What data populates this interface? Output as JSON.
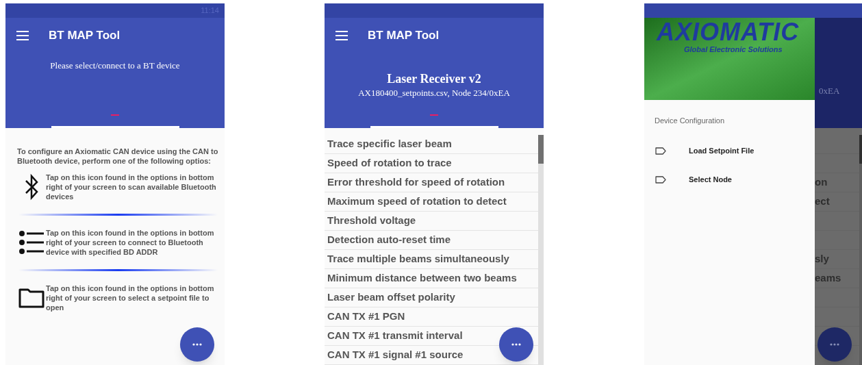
{
  "screens": [
    {
      "kind": "welcome",
      "status_bar": {
        "time": "11:14"
      },
      "app_bar": {
        "title": "BT MAP Tool",
        "message": "Please select/connect to a BT device"
      },
      "intro": "To configure an Axiomatic CAN device using the CAN to Bluetooth device, perform one of the following optios:",
      "options": [
        {
          "kind": "bluetooth",
          "text": "Tap on this icon found in the options in bottom right of your screen to scan available Bluetooth devices"
        },
        {
          "kind": "list",
          "text": "Tap on this icon found in the options in bottom right of your screen to connect to Bluetooth device with specified BD ADDR"
        },
        {
          "kind": "folder",
          "text": "Tap on this icon found in the options in bottom right of your screen to select a setpoint file to open"
        }
      ]
    },
    {
      "kind": "settings_list",
      "app_bar": {
        "title": "BT MAP Tool",
        "device_name": "Laser Receiver v2",
        "device_info": "AX180400_setpoints.csv, Node 234/0xEA"
      },
      "items": [
        "Trace specific laser beam",
        "Speed of rotation to trace",
        "Error threshold for speed of rotation",
        "Maximum speed of rotation to detect",
        "Threshold voltage",
        "Detection auto-reset time",
        "Trace multiple beams simultaneously",
        "Minimum distance between two beams",
        "Laser beam offset polarity",
        "CAN TX #1 PGN",
        "CAN TX #1 transmit interval",
        "CAN TX #1 signal #1 source"
      ]
    },
    {
      "kind": "drawer_open",
      "drawer": {
        "logo_text": "AXIOMATIC",
        "logo_tagline": "Global Electronic Solutions",
        "section": "Device Configuration",
        "items": [
          "Load Setpoint File",
          "Select Node"
        ]
      },
      "behind": {
        "header_fragment": "0xEA",
        "row_fragments": [
          "on",
          "ect",
          "sly",
          "eams"
        ]
      }
    }
  ]
}
